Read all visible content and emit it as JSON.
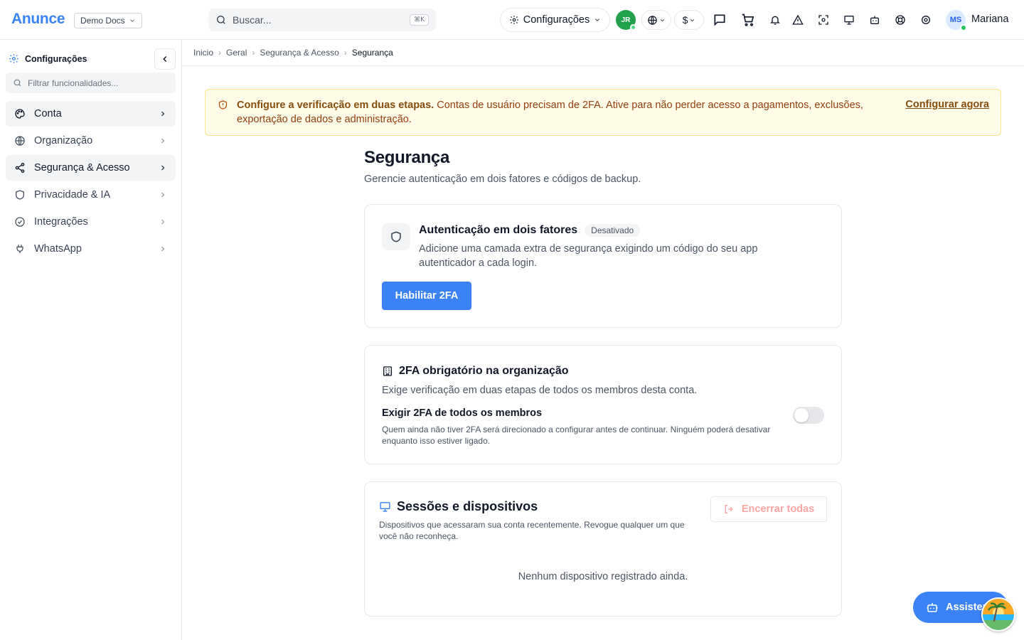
{
  "header": {
    "logo": "Anunce",
    "workspace": "Demo Docs",
    "search_placeholder": "Buscar...",
    "search_shortcut": "⌘K",
    "settings_label": "Configurações",
    "user_initials_jr": "JR",
    "currency": "$",
    "avatar_initials": "MS",
    "username": "Mariana"
  },
  "sidebar": {
    "title": "Configurações",
    "filter_placeholder": "Filtrar funcionalidades...",
    "items": [
      {
        "label": "Conta",
        "icon": "palette-icon"
      },
      {
        "label": "Organização",
        "icon": "globe-icon"
      },
      {
        "label": "Segurança & Acesso",
        "icon": "share-icon"
      },
      {
        "label": "Privacidade & IA",
        "icon": "shield-icon"
      },
      {
        "label": "Integrações",
        "icon": "check-circle-icon"
      },
      {
        "label": "WhatsApp",
        "icon": "plug-icon"
      }
    ]
  },
  "breadcrumb": [
    "Inicio",
    "Geral",
    "Segurança & Acesso",
    "Segurança"
  ],
  "alert": {
    "title": "Configure a verificação em duas etapas.",
    "body": "Contas de usuário precisam de 2FA. Ative para não perder acesso a pagamentos, exclusões, exportação de dados e administração.",
    "link": "Configurar agora"
  },
  "page": {
    "title": "Segurança",
    "subtitle": "Gerencie autenticação em dois fatores e códigos de backup."
  },
  "two_factor": {
    "title": "Autenticação em dois fatores",
    "status": "Desativado",
    "description": "Adicione uma camada extra de segurança exigindo um código do seu app autenticador a cada login.",
    "button": "Habilitar 2FA"
  },
  "org_2fa": {
    "title": "2FA obrigatório na organização",
    "description": "Exige verificação em duas etapas de todos os membros desta conta.",
    "toggle_label": "Exigir 2FA de todos os membros",
    "toggle_help": "Quem ainda não tiver 2FA será direcionado a configurar antes de continuar. Ninguém poderá desativar enquanto isso estiver ligado.",
    "enabled": false
  },
  "sessions": {
    "title": "Sessões e dispositivos",
    "description": "Dispositivos que acessaram sua conta recentemente. Revogue qualquer um que você não reconheça.",
    "end_all": "Encerrar todas",
    "empty": "Nenhum dispositivo registrado ainda."
  },
  "assistant": {
    "label": "Assistente"
  },
  "colors": {
    "accent": "#3b82f6",
    "alert_bg": "#fefce8",
    "alert_text": "#92400e",
    "danger_muted": "#fca5a5"
  }
}
